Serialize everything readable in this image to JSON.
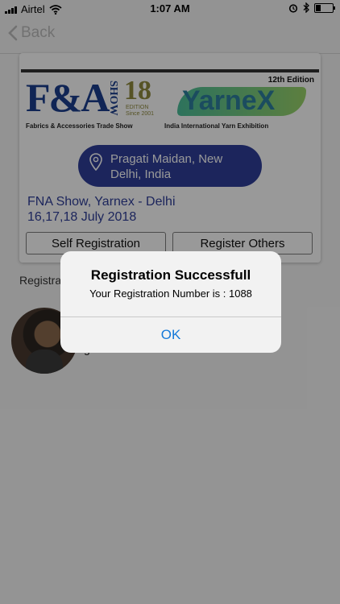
{
  "status_bar": {
    "carrier": "Airtel",
    "time": "1:07 AM",
    "icons": [
      "signal-icon",
      "wifi-icon",
      "alarm-icon",
      "bluetooth-icon",
      "battery-icon"
    ]
  },
  "nav": {
    "back_label": "Back"
  },
  "event": {
    "logo_left_text": "F&A",
    "logo_left_show": "SHOW",
    "logo_left_number": "18",
    "logo_left_edition": "EDITION Since 2001",
    "logo_left_subtitle": "Fabrics & Accessories Trade Show",
    "logo_right_edition": "12th Edition",
    "logo_right_name": "YarneX",
    "logo_right_subtitle": "India International Yarn Exhibition",
    "location": "Pragati Maidan, New Delhi, India",
    "title_line1": "FNA Show, Yarnex - Delhi",
    "title_line2": "16,17,18 July 2018",
    "self_registration_label": "Self Registration",
    "register_others_label": "Register Others"
  },
  "registrations": {
    "label": "Registra",
    "person_name": "g"
  },
  "alert": {
    "title": "Registration Successfull",
    "message": "Your Registration Number is : 1088",
    "ok_label": "OK"
  },
  "colors": {
    "primary": "#2f3f9a",
    "ios_blue": "#1479d9"
  }
}
